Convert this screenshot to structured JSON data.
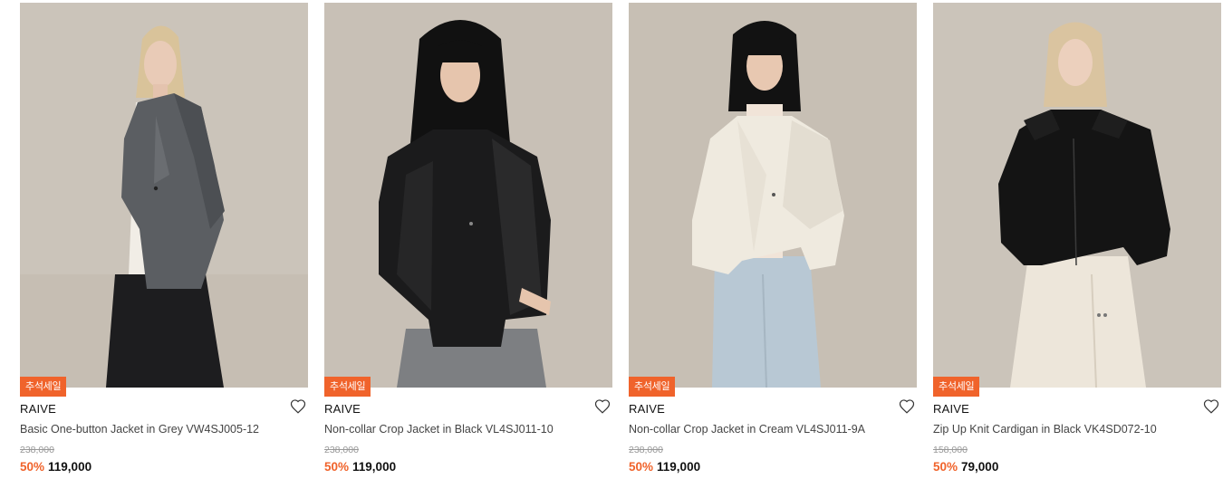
{
  "products": [
    {
      "badge": "추석세일",
      "brand": "RAIVE",
      "name": "Basic One-button Jacket in Grey VW4SJ005-12",
      "original_price": "238,000",
      "discount": "50%",
      "price": "119,000",
      "photo": "model-grey-jacket"
    },
    {
      "badge": "추석세일",
      "brand": "RAIVE",
      "name": "Non-collar Crop Jacket in Black VL4SJ011-10",
      "original_price": "238,000",
      "discount": "50%",
      "price": "119,000",
      "photo": "model-black-leather-jacket"
    },
    {
      "badge": "추석세일",
      "brand": "RAIVE",
      "name": "Non-collar Crop Jacket in Cream VL4SJ011-9A",
      "original_price": "238,000",
      "discount": "50%",
      "price": "119,000",
      "photo": "model-cream-jacket"
    },
    {
      "badge": "추석세일",
      "brand": "RAIVE",
      "name": "Zip Up Knit Cardigan in Black VK4SD072-10",
      "original_price": "158,000",
      "discount": "50%",
      "price": "79,000",
      "photo": "model-black-cardigan"
    }
  ],
  "colors": {
    "accent": "#f0632b",
    "backdrop": "#c9c1b7"
  },
  "icons": {
    "wishlist": "heart-outline-icon"
  }
}
